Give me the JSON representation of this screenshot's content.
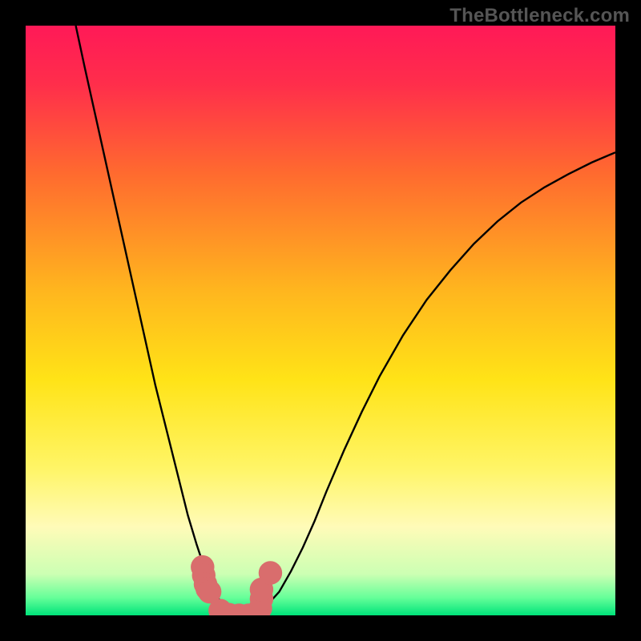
{
  "watermark": "TheBottleneck.com",
  "chart_data": {
    "type": "line",
    "title": "",
    "xlabel": "",
    "ylabel": "",
    "xlim": [
      0,
      1
    ],
    "ylim": [
      0,
      1
    ],
    "background": {
      "type": "vertical-gradient",
      "stops": [
        {
          "pos": 0.0,
          "color": "#ff1957"
        },
        {
          "pos": 0.1,
          "color": "#ff2e4b"
        },
        {
          "pos": 0.25,
          "color": "#ff6a2f"
        },
        {
          "pos": 0.45,
          "color": "#ffb61e"
        },
        {
          "pos": 0.6,
          "color": "#ffe317"
        },
        {
          "pos": 0.75,
          "color": "#fff566"
        },
        {
          "pos": 0.85,
          "color": "#fffbb8"
        },
        {
          "pos": 0.93,
          "color": "#ccffb3"
        },
        {
          "pos": 0.97,
          "color": "#66ff99"
        },
        {
          "pos": 1.0,
          "color": "#00e37a"
        }
      ]
    },
    "series": [
      {
        "name": "bottleneck-curve",
        "color": "#000000",
        "stroke_width": 2,
        "x": [
          0.085,
          0.1,
          0.12,
          0.14,
          0.16,
          0.18,
          0.2,
          0.22,
          0.24,
          0.26,
          0.275,
          0.29,
          0.305,
          0.32,
          0.335,
          0.35,
          0.37,
          0.39,
          0.41,
          0.43,
          0.45,
          0.47,
          0.49,
          0.51,
          0.54,
          0.57,
          0.6,
          0.64,
          0.68,
          0.72,
          0.76,
          0.8,
          0.84,
          0.88,
          0.92,
          0.96,
          1.0
        ],
        "y": [
          1.0,
          0.93,
          0.84,
          0.75,
          0.66,
          0.57,
          0.48,
          0.39,
          0.31,
          0.23,
          0.17,
          0.12,
          0.075,
          0.04,
          0.016,
          0.004,
          0.0,
          0.004,
          0.018,
          0.04,
          0.075,
          0.115,
          0.16,
          0.21,
          0.28,
          0.345,
          0.405,
          0.475,
          0.535,
          0.585,
          0.63,
          0.668,
          0.7,
          0.726,
          0.748,
          0.768,
          0.785
        ]
      }
    ],
    "overlay_points": {
      "name": "detail-markers",
      "color": "#d96d6d",
      "radius_rel": 0.02,
      "points": [
        {
          "x": 0.3,
          "y": 0.082
        },
        {
          "x": 0.302,
          "y": 0.068
        },
        {
          "x": 0.305,
          "y": 0.053
        },
        {
          "x": 0.308,
          "y": 0.045
        },
        {
          "x": 0.312,
          "y": 0.04
        },
        {
          "x": 0.33,
          "y": 0.008
        },
        {
          "x": 0.345,
          "y": 0.001
        },
        {
          "x": 0.362,
          "y": 0.0
        },
        {
          "x": 0.378,
          "y": 0.0
        },
        {
          "x": 0.392,
          "y": 0.002
        },
        {
          "x": 0.398,
          "y": 0.012
        },
        {
          "x": 0.4,
          "y": 0.028
        },
        {
          "x": 0.4,
          "y": 0.044
        },
        {
          "x": 0.415,
          "y": 0.072
        }
      ]
    }
  }
}
